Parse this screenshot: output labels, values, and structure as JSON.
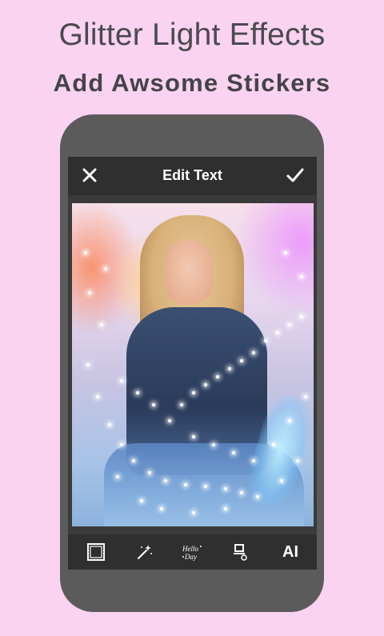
{
  "promo": {
    "headline": "Glitter Light Effects",
    "subline": "Add Awsome Stickers"
  },
  "app": {
    "topbar": {
      "title": "Edit Text",
      "close_icon": "close-icon",
      "confirm_icon": "check-icon"
    },
    "toolbar": {
      "items": [
        {
          "icon": "frame-icon"
        },
        {
          "icon": "magic-wand-icon"
        },
        {
          "icon": "sticker-icon"
        },
        {
          "icon": "stamp-icon"
        },
        {
          "icon": "text-icon",
          "label": "AI"
        }
      ]
    }
  },
  "colors": {
    "background": "#fad3f1",
    "phone_body": "#5b5b5b",
    "bar": "#2f2f2f",
    "text": "#ffffff"
  }
}
